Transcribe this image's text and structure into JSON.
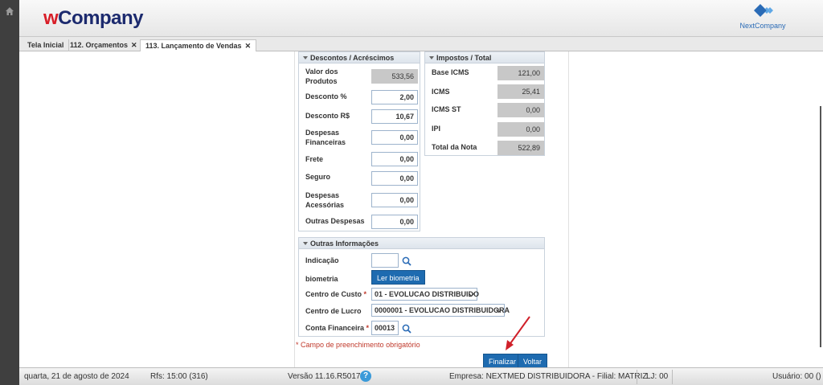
{
  "header": {
    "logo_w": "w",
    "logo_company": "Company",
    "brand_right": "NextCompany"
  },
  "tabs": [
    {
      "label": "Tela Inicial",
      "closable": false
    },
    {
      "label": "112. Orçamentos",
      "closable": true
    },
    {
      "label": "113. Lançamento de Vendas",
      "closable": true
    }
  ],
  "tab_close_glyph": "✕",
  "descontos": {
    "title": "Descontos / Acréscimos",
    "rows": [
      {
        "label": "Valor dos Produtos",
        "value": "533,56",
        "readonly": true
      },
      {
        "label": "Desconto %",
        "value": "2,00",
        "readonly": false
      },
      {
        "label": "Desconto R$",
        "value": "10,67",
        "readonly": false
      },
      {
        "label": "Despesas Financeiras",
        "value": "0,00",
        "readonly": false
      },
      {
        "label": "Frete",
        "value": "0,00",
        "readonly": false
      },
      {
        "label": "Seguro",
        "value": "0,00",
        "readonly": false
      },
      {
        "label": "Despesas Acessórias",
        "value": "0,00",
        "readonly": false
      },
      {
        "label": "Outras Despesas",
        "value": "0,00",
        "readonly": false
      }
    ]
  },
  "impostos": {
    "title": "Impostos / Total",
    "rows": [
      {
        "label": "Base ICMS",
        "value": "121,00"
      },
      {
        "label": "ICMS",
        "value": "25,41"
      },
      {
        "label": "ICMS ST",
        "value": "0,00"
      },
      {
        "label": "IPI",
        "value": "0,00"
      },
      {
        "label": "Total da Nota",
        "value": "522,89"
      }
    ]
  },
  "outras": {
    "title": "Outras Informações",
    "indicacao_label": "Indicação",
    "indicacao_value": "",
    "biometria_label": "biometria",
    "biometria_button": "Ler biometria",
    "centro_custo_label": "Centro de Custo",
    "centro_custo_value": "01 - EVOLUCAO DISTRIBUIDO",
    "centro_lucro_label": "Centro de Lucro",
    "centro_lucro_value": "0000001 - EVOLUCAO DISTRIBUIDORA",
    "conta_label": "Conta Financeira",
    "conta_value": "00013",
    "required_mark": "*"
  },
  "required_note": "* Campo de preenchimento obrigatório",
  "actions": {
    "finalizar": "Finalizar",
    "voltar": "Voltar"
  },
  "status": {
    "date": "quarta, 21 de agosto de 2024",
    "rfs": "Rfs: 15:00 (316)",
    "version": "Versão 11.16.R5017",
    "help": "?",
    "empresa": "Empresa: NEXTMED DISTRIBUIDORA - Filial: MATRIZ",
    "lj": "LJ: 00",
    "usuario": "Usuário: 00 ()"
  },
  "colors": {
    "accent": "#1e6bb0",
    "required": "#c0392b",
    "arrow": "#d0202a"
  }
}
